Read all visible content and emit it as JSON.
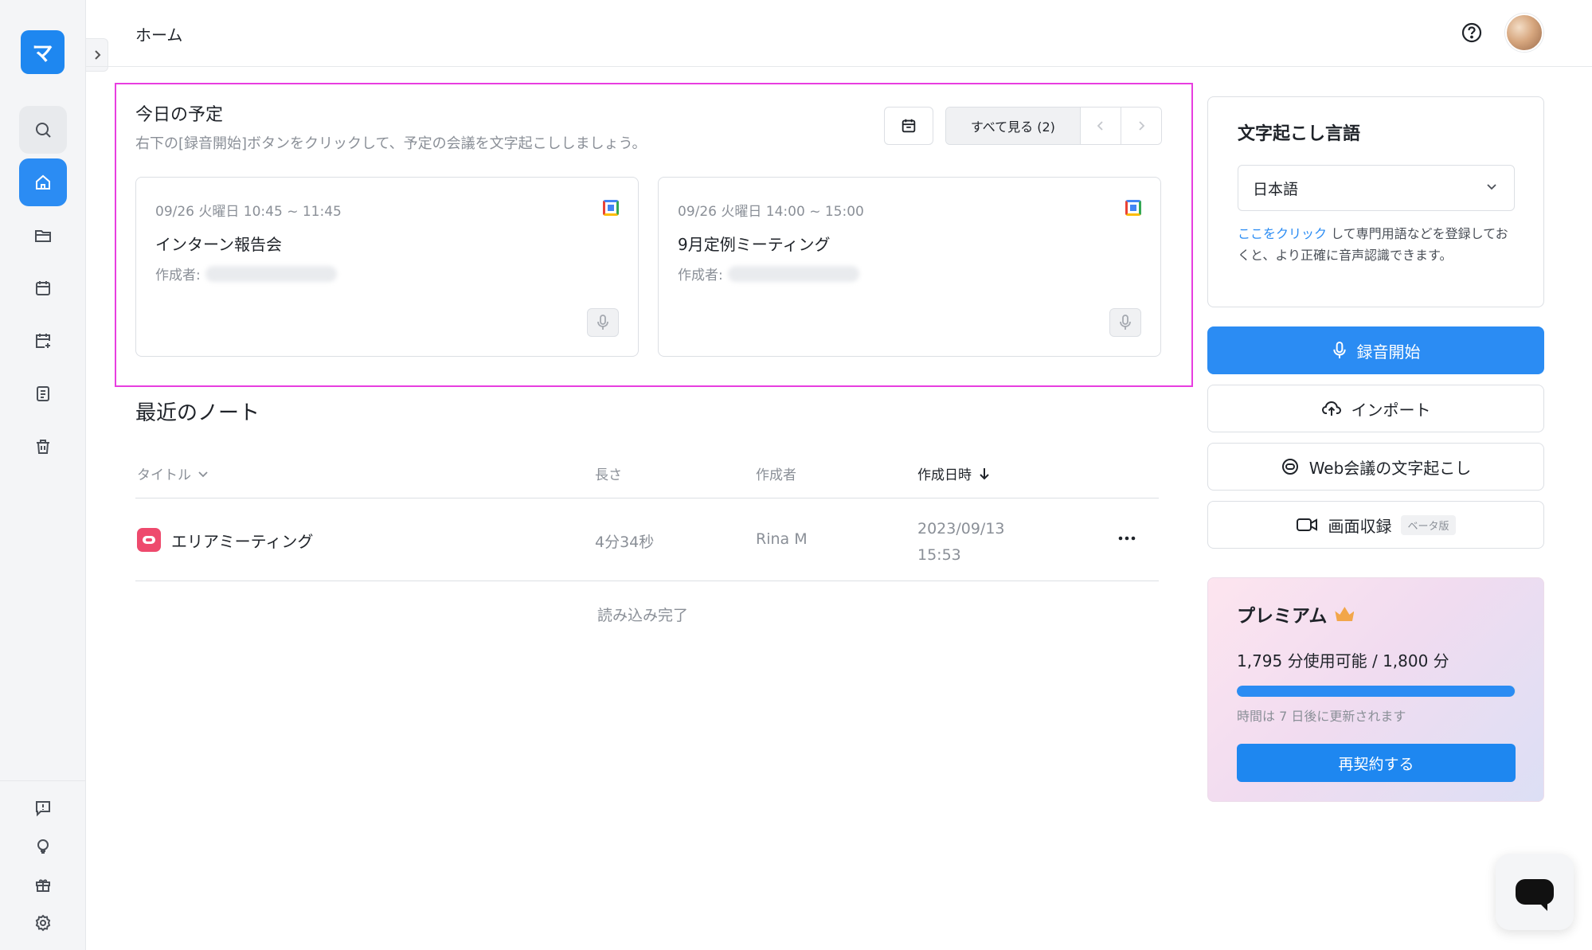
{
  "app": {
    "logo_glyph": "マ",
    "accent_color": "#2b8cf3",
    "highlight_color": "#e83ee0"
  },
  "topbar": {
    "title": "ホーム"
  },
  "sidebar": {
    "items": [
      {
        "icon": "search-icon"
      },
      {
        "icon": "home-icon",
        "active": true
      },
      {
        "icon": "folder-icon"
      },
      {
        "icon": "calendar-icon"
      },
      {
        "icon": "calendar-plus-icon"
      },
      {
        "icon": "document-icon"
      },
      {
        "icon": "trash-icon"
      }
    ],
    "bottom_items": [
      {
        "icon": "feedback-icon"
      },
      {
        "icon": "lightbulb-icon"
      },
      {
        "icon": "gift-icon"
      },
      {
        "icon": "settings-icon"
      }
    ]
  },
  "schedule": {
    "title": "今日の予定",
    "description": "右下の[録音開始]ボタンをクリックして、予定の会議を文字起こししましょう。",
    "see_all_label": "すべて見る (2)",
    "events": [
      {
        "time": "09/26 火曜日 10:45 ~ 11:45",
        "title": "インターン報告会",
        "creator_label": "作成者:"
      },
      {
        "time": "09/26 火曜日 14:00 ~ 15:00",
        "title": "9月定例ミーティング",
        "creator_label": "作成者:"
      }
    ]
  },
  "notes": {
    "title": "最近のノート",
    "columns": {
      "title": "タイトル",
      "length": "長さ",
      "author": "作成者",
      "created": "作成日時"
    },
    "rows": [
      {
        "title": "エリアミーティング",
        "length": "4分34秒",
        "author": "Rina M",
        "date": "2023/09/13",
        "time": "15:53"
      }
    ],
    "load_complete": "読み込み完了"
  },
  "language": {
    "title": "文字起こし言語",
    "selected": "日本語",
    "hint_link": "ここをクリック",
    "hint_text": " して専門用語などを登録しておくと、より正確に音声認識できます。"
  },
  "actions": {
    "record": "録音開始",
    "import": "インポート",
    "web_meeting": "Web会議の文字起こし",
    "screen_record": "画面収録",
    "beta_badge": "ベータ版"
  },
  "premium": {
    "title": "プレミアム",
    "usage": "1,795 分使用可能 / 1,800 分",
    "usage_fraction": 0.997,
    "renew_text": "時間は 7 日後に更新されます",
    "button": "再契約する"
  }
}
